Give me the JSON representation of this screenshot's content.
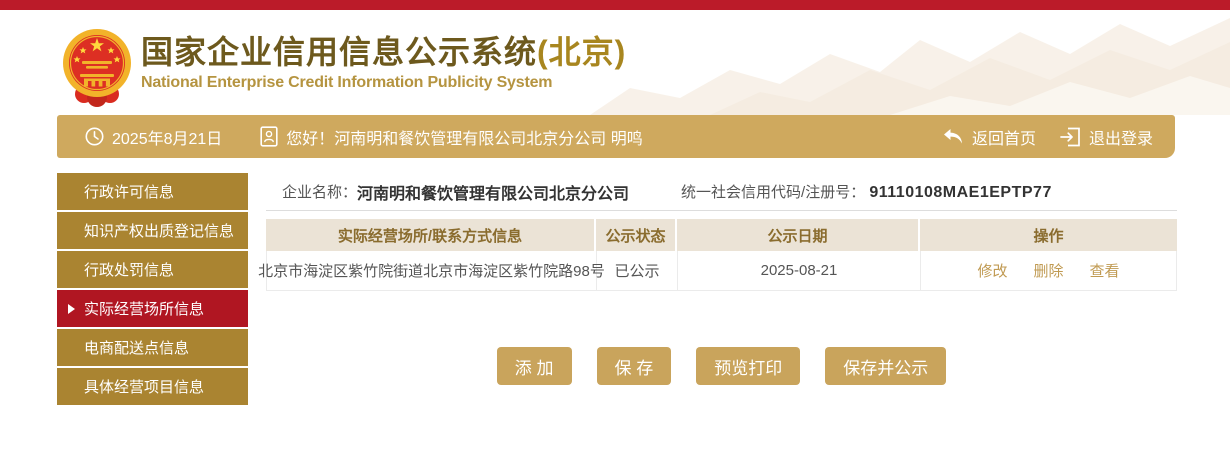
{
  "header": {
    "title_cn": "国家企业信用信息公示系统",
    "title_region": "(北京)",
    "subtitle_en": "National Enterprise Credit Information Publicity System"
  },
  "topbar": {
    "date": "2025年8月21日",
    "greeting": "您好！河南明和餐饮管理有限公司北京分公司  明鸣",
    "back_home": "返回首页",
    "logout": "退出登录"
  },
  "sidebar": {
    "items": [
      {
        "label": "行政许可信息",
        "active": false
      },
      {
        "label": "知识产权出质登记信息",
        "active": false
      },
      {
        "label": "行政处罚信息",
        "active": false
      },
      {
        "label": "实际经营场所信息",
        "active": true
      },
      {
        "label": "电商配送点信息",
        "active": false
      },
      {
        "label": "具体经营项目信息",
        "active": false
      }
    ]
  },
  "main": {
    "company_label": "企业名称：",
    "company_name": "河南明和餐饮管理有限公司北京分公司",
    "credit_code_label": "统一社会信用代码/注册号：",
    "credit_code": "91110108MAE1EPTP77",
    "table": {
      "headers": [
        "实际经营场所/联系方式信息",
        "公示状态",
        "公示日期",
        "操作"
      ],
      "rows": [
        {
          "address": "北京市海淀区紫竹院街道北京市海淀区紫竹院路98号",
          "status": "已公示",
          "date": "2025-08-21",
          "actions": [
            "修改",
            "删除",
            "查看"
          ]
        }
      ]
    },
    "buttons": [
      "添 加",
      "保 存",
      "预览打印",
      "保存并公示"
    ]
  },
  "icons": {
    "emblem": "china-national-emblem",
    "clock": "clock-icon",
    "user_badge": "id-badge-icon",
    "back": "return-arrow-icon",
    "logout": "logout-icon",
    "active_marker": "triangle-right-icon"
  },
  "colors": {
    "top_strip": "#bb1b29",
    "gold_bar": "#cfa95e",
    "sidebar_item": "#aa8431",
    "sidebar_active": "#b01622",
    "button_gold": "#c9a45c",
    "table_header_bg": "#ebe3d6",
    "table_header_text": "#8a6c2e",
    "title_dark_gold": "#6d591d",
    "title_region_gold": "#a8861f",
    "subtitle_gold": "#b59440",
    "action_link": "#c09a52"
  }
}
